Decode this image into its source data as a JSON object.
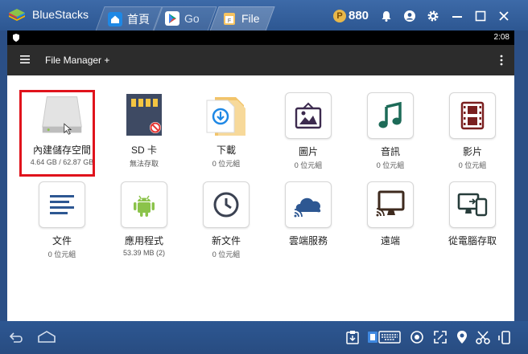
{
  "window": {
    "brand": "BlueStacks",
    "tabs": [
      {
        "label": "首頁",
        "icon": "home-icon"
      },
      {
        "label": "Go",
        "icon": "play-store-icon"
      },
      {
        "label": "File",
        "icon": "file-manager-icon"
      }
    ],
    "coins": "880",
    "colors": {
      "titlebar": "#2d5792",
      "accent_red": "#e0131c"
    }
  },
  "status_bar": {
    "time": "2:08"
  },
  "app_bar": {
    "title": "File Manager +"
  },
  "grid": {
    "items": [
      {
        "label": "內建儲存空間",
        "sub": "4.64 GB / 62.87 GB",
        "icon": "hard-drive-icon"
      },
      {
        "label": "SD 卡",
        "sub": "無法存取",
        "icon": "sd-card-icon"
      },
      {
        "label": "下載",
        "sub": "0 位元組",
        "icon": "download-folder-icon"
      },
      {
        "label": "圖片",
        "sub": "0 位元組",
        "icon": "picture-icon"
      },
      {
        "label": "音訊",
        "sub": "0 位元組",
        "icon": "music-note-icon"
      },
      {
        "label": "影片",
        "sub": "0 位元組",
        "icon": "film-icon"
      },
      {
        "label": "文件",
        "sub": "0 位元組",
        "icon": "document-icon"
      },
      {
        "label": "應用程式",
        "sub": "53.39 MB (2)",
        "icon": "android-icon"
      },
      {
        "label": "新文件",
        "sub": "0 位元組",
        "icon": "clock-icon"
      },
      {
        "label": "雲端服務",
        "sub": "",
        "icon": "cloud-icon"
      },
      {
        "label": "遠端",
        "sub": "",
        "icon": "remote-monitor-icon"
      },
      {
        "label": "從電腦存取",
        "sub": "",
        "icon": "pc-access-icon"
      }
    ]
  }
}
